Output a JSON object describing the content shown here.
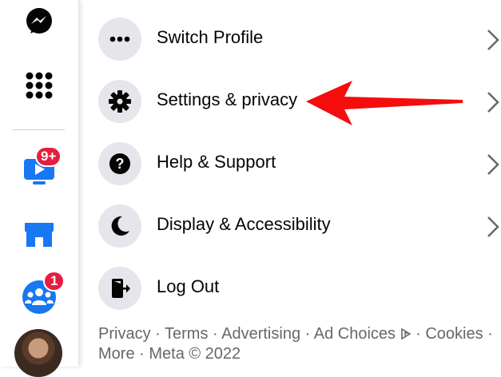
{
  "colors": {
    "accent_red": "#e41e3f",
    "arrow_red": "#f50d0d",
    "circle_bg": "#e4e6eb",
    "primary_text": "#050505",
    "secondary_text": "#65676b",
    "rail_icon_blue": "#1877f2"
  },
  "rail": {
    "items": [
      {
        "name": "messenger",
        "icon": "messenger-icon"
      },
      {
        "name": "menu",
        "icon": "grid-icon"
      },
      {
        "name": "watch",
        "icon": "video-icon",
        "badge": "9+"
      },
      {
        "name": "marketplace",
        "icon": "shop-icon"
      },
      {
        "name": "groups",
        "icon": "groups-icon",
        "badge": "1"
      },
      {
        "name": "profile",
        "icon": "avatar"
      }
    ]
  },
  "menu": {
    "items": [
      {
        "label": "Switch Profile",
        "icon": "ellipsis-icon",
        "has_chevron": true
      },
      {
        "label": "Settings & privacy",
        "icon": "gear-icon",
        "has_chevron": true
      },
      {
        "label": "Help & Support",
        "icon": "question-icon",
        "has_chevron": true
      },
      {
        "label": "Display & Accessibility",
        "icon": "moon-icon",
        "has_chevron": true
      },
      {
        "label": "Log Out",
        "icon": "logout-icon",
        "has_chevron": false
      }
    ]
  },
  "footer": {
    "privacy": "Privacy",
    "terms": "Terms",
    "advertising": "Advertising",
    "ad_choices": "Ad Choices",
    "cookies": "Cookies",
    "more": "More",
    "meta": "Meta © 2022",
    "separator": " · "
  }
}
